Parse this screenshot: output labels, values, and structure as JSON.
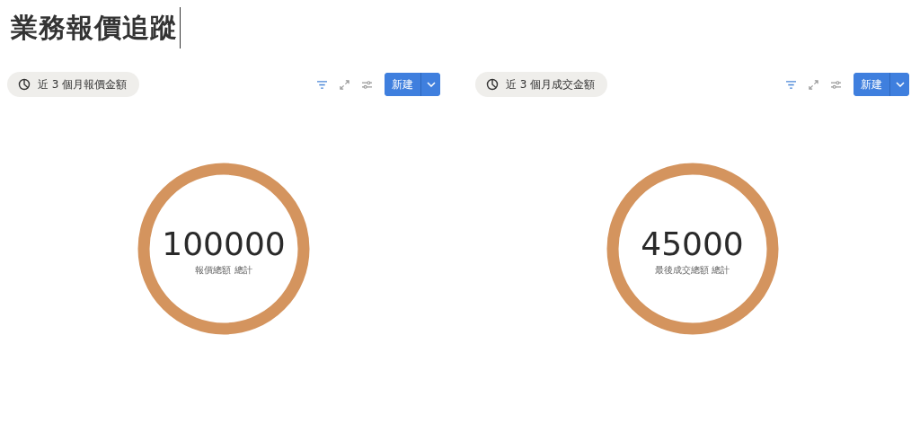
{
  "title": "業務報價追蹤",
  "panels": [
    {
      "view_label": "近 3 個月報價金額",
      "new_button": "新建",
      "value": "100000",
      "caption": "報價總額 總計"
    },
    {
      "view_label": "近 3 個月成交金額",
      "new_button": "新建",
      "value": "45000",
      "caption": "最後成交總額 總計"
    }
  ]
}
